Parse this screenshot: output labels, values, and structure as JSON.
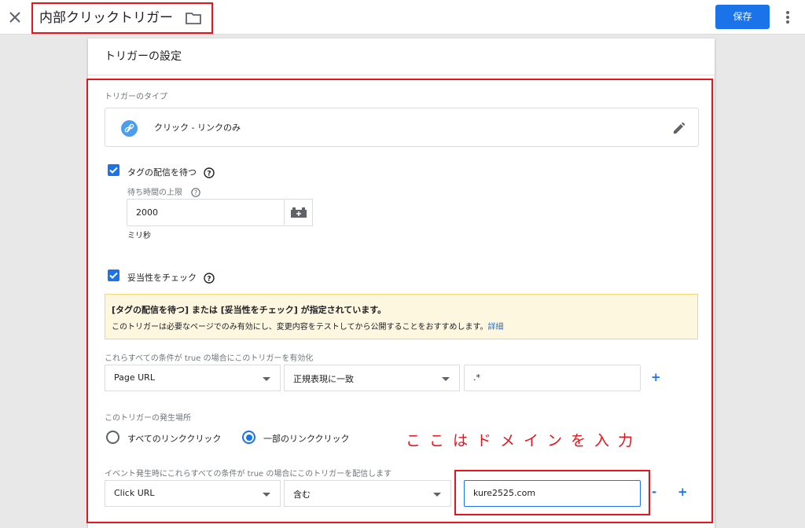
{
  "header": {
    "title": "内部クリックトリガー",
    "save_label": "保存"
  },
  "panel": {
    "title": "トリガーの設定"
  },
  "trigger_type": {
    "label": "トリガーのタイプ",
    "name": "クリック - リンクのみ"
  },
  "wait_for_tags": {
    "label": "タグの配信を待つ",
    "checked": true,
    "max_wait_label": "待ち時間の上限",
    "max_wait_value": "2000",
    "unit": "ミリ秒"
  },
  "check_validation": {
    "label": "妥当性をチェック",
    "checked": true
  },
  "notice": {
    "heading": "[タグの配信を待つ] または [妥当性をチェック] が指定されています。",
    "body": "このトリガーは必要なページでのみ有効にし、変更内容をテストしてから公開することをおすすめします。",
    "link": "詳細"
  },
  "enable_conditions": {
    "label": "これらすべての条件が true の場合にこのトリガーを有効化",
    "variable": "Page URL",
    "operator": "正規表現に一致",
    "value": ".*",
    "add": "+"
  },
  "fires_on": {
    "label": "このトリガーの発生場所",
    "options": [
      "すべてのリンククリック",
      "一部のリンククリック"
    ],
    "selected": "一部のリンククリック"
  },
  "fire_conditions": {
    "label": "イベント発生時にこれらすべての条件が true の場合にこのトリガーを配信します",
    "variable": "Click URL",
    "operator": "含む",
    "value": "kure2525.com",
    "remove": "-",
    "add": "+"
  },
  "annotation": "ここはドメインを入力",
  "colors": {
    "accent": "#1a73e8",
    "annotation_red": "#e8141c",
    "notice_bg": "#fef7e0"
  }
}
